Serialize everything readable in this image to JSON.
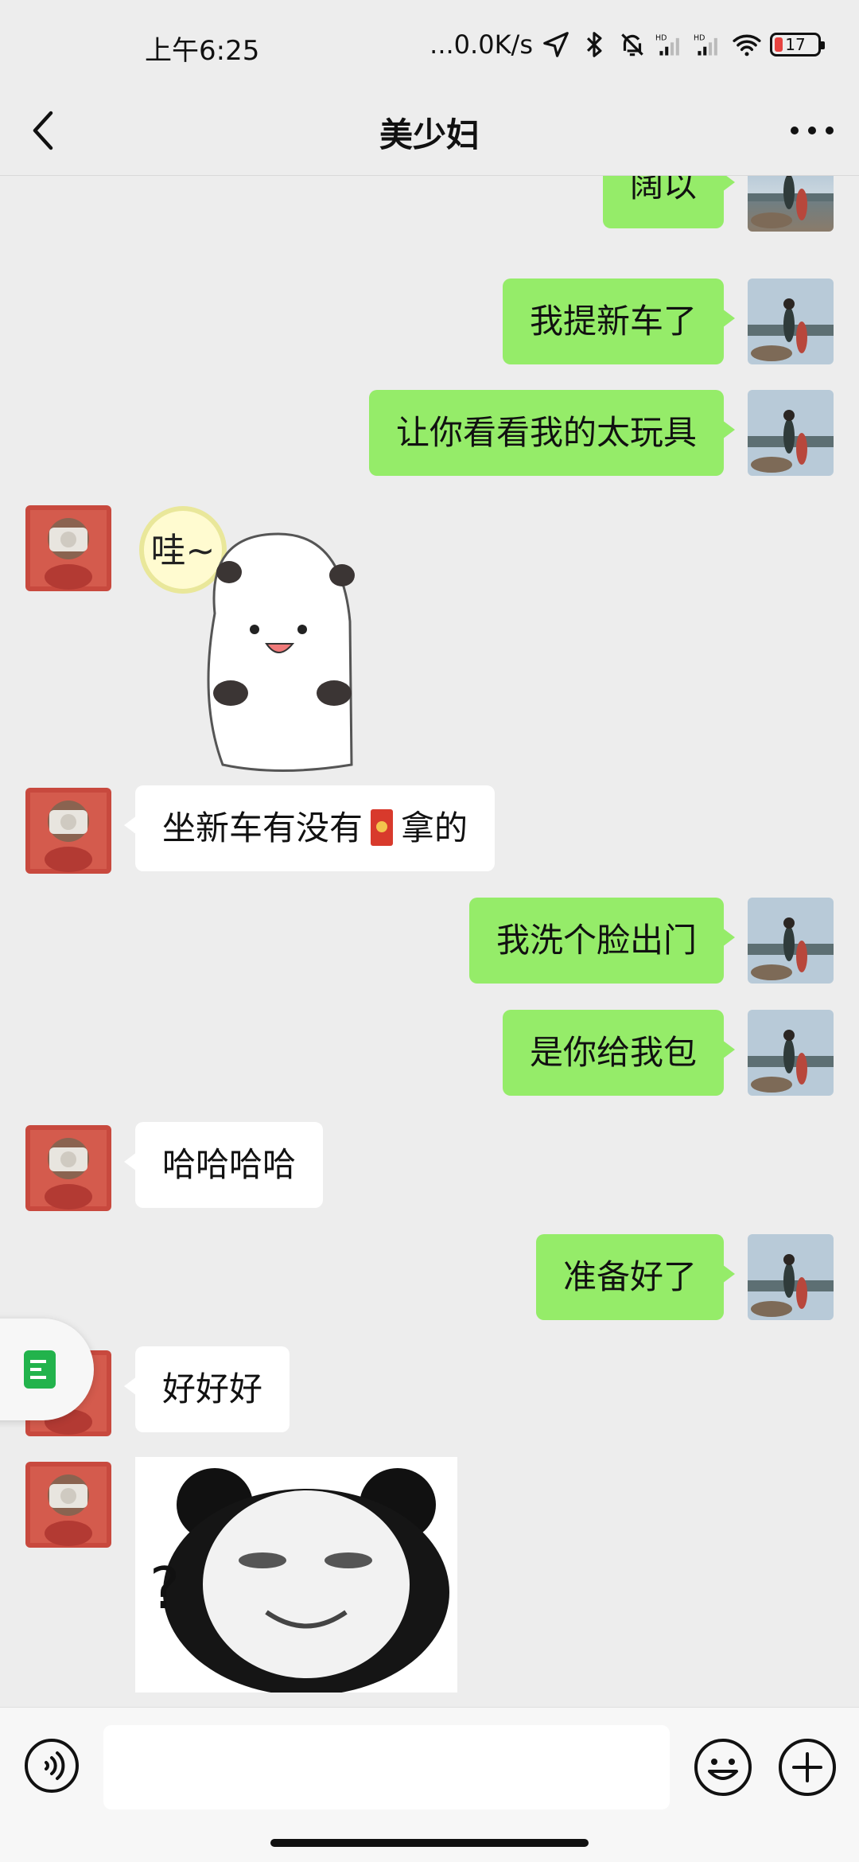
{
  "status_bar": {
    "time": "上午6:25",
    "net_speed": "...0.0K/s",
    "battery": "17",
    "icons": [
      "location-icon",
      "bluetooth-icon",
      "mute-bell-icon",
      "hd-signal-icon",
      "hd-signal-icon",
      "wifi-icon",
      "battery-icon"
    ]
  },
  "nav": {
    "title": "美少妇",
    "icons": [
      "back-arrow-icon",
      "more-dots-icon"
    ]
  },
  "messages": [
    {
      "side": "right",
      "type": "text",
      "text": "阔以"
    },
    {
      "side": "right",
      "type": "text",
      "text": "我提新车了"
    },
    {
      "side": "right",
      "type": "text",
      "text": "让你看看我的太玩具"
    },
    {
      "side": "left",
      "type": "sticker",
      "text": "哇~"
    },
    {
      "side": "left",
      "type": "text",
      "text_before": "坐新车有没有",
      "icon": "red-packet-icon",
      "text_after": "拿的"
    },
    {
      "side": "right",
      "type": "text",
      "text": "我洗个脸出门"
    },
    {
      "side": "right",
      "type": "text",
      "text": "是你给我包"
    },
    {
      "side": "left",
      "type": "text",
      "text": "哈哈哈哈"
    },
    {
      "side": "right",
      "type": "text",
      "text": "准备好了"
    },
    {
      "side": "left",
      "type": "text",
      "text": "好好好"
    },
    {
      "side": "left",
      "type": "sticker",
      "text": "?"
    }
  ],
  "input_bar": {
    "placeholder": "",
    "icons": [
      "voice-icon",
      "emoji-icon",
      "plus-icon"
    ]
  },
  "colors": {
    "background": "#ededed",
    "self_bubble": "#95ec69",
    "other_bubble": "#ffffff",
    "battery_low": "#e64340"
  }
}
